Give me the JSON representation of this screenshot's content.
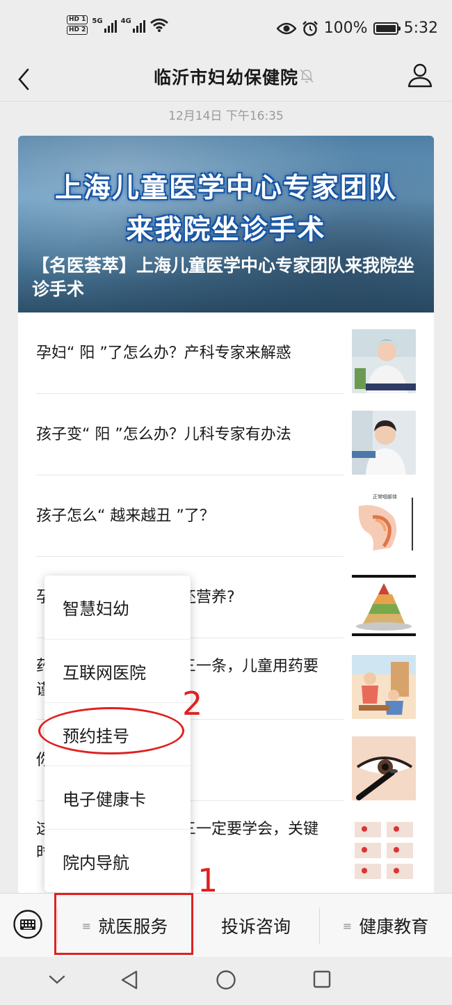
{
  "status_bar": {
    "hd1": "HD 1",
    "hd2": "HD 2",
    "signal1_label": "5G",
    "signal2_label": "4G",
    "battery_percent": "100%",
    "time": "5:32"
  },
  "nav": {
    "title": "临沂市妇幼保健院"
  },
  "timestamp": "12月14日 下午16:35",
  "banner": {
    "headline_line1": "上海儿童医学中心专家团队",
    "headline_line2": "来我院坐诊手术",
    "caption": "【名医荟萃】上海儿童医学中心专家团队来我院坐诊手术"
  },
  "articles": [
    {
      "title": "孕妇“ 阳 ”了怎么办？产科专家来解惑",
      "thumb": "doctor-photo"
    },
    {
      "title": "孩子变“ 阳 ”怎么办？儿科专家有办法",
      "thumb": "doctor-photo"
    },
    {
      "title": "孩子怎么“ 越来越丑 ”了？",
      "thumb": "anatomy-diagram",
      "thumb_caption": "正常咽部体"
    },
    {
      "title": "孕…还营养？",
      "visible_prefix": "孕",
      "visible_suffix": "还营养?",
      "thumb": "food-pyramid"
    },
    {
      "title": "药…一条，儿童用药要谨…",
      "visible_prefix": "药",
      "visible_suffix": "三一条，儿童用药要",
      "visible_line2": "谨",
      "thumb": "cartoon-illustration"
    },
    {
      "title": "你…",
      "visible_prefix": "你",
      "thumb": "eye-makeup-photo"
    },
    {
      "title": "这…一定要学会，关键时…",
      "visible_prefix": "这",
      "visible_suffix": "三一定要学会，关键",
      "visible_line2": "时",
      "thumb": "first-aid-steps"
    }
  ],
  "popup_menu": {
    "items": [
      "智慧妇幼",
      "互联网医院",
      "预约挂号",
      "电子健康卡",
      "院内导航"
    ]
  },
  "bottom_menu": {
    "items": [
      "就医服务",
      "投诉咨询",
      "健康教育"
    ]
  },
  "annotations": {
    "step1": "1",
    "step2": "2",
    "color": "#e02020"
  }
}
